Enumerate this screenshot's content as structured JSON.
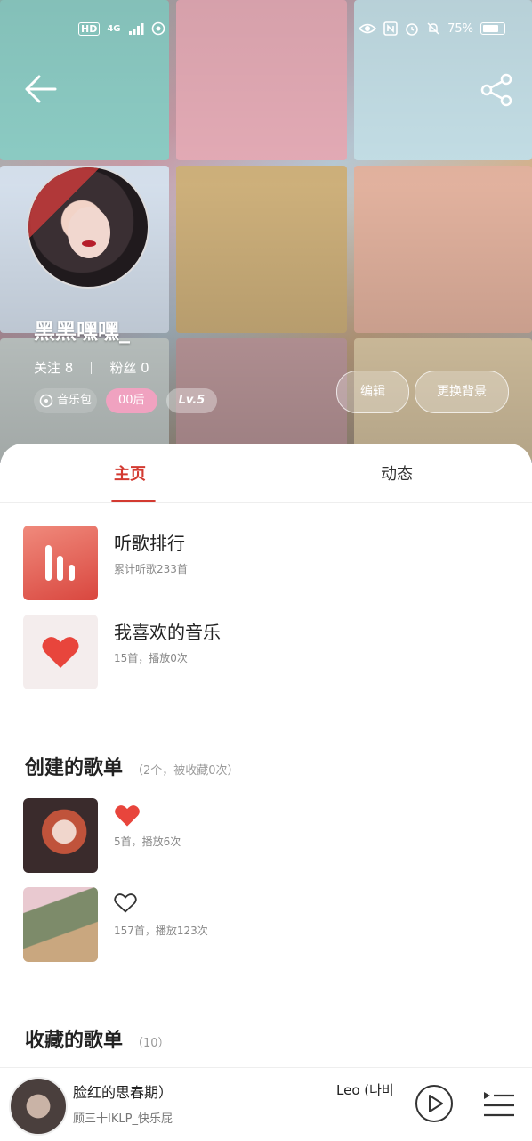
{
  "status_bar": {
    "left": [
      "HD",
      "4G",
      "signal-icon",
      "hotspot-icon"
    ],
    "battery_percent": "75%",
    "icons_right": [
      "eye-icon",
      "nfc-icon",
      "alarm-icon",
      "mute-icon",
      "battery-icon"
    ]
  },
  "profile": {
    "username": "黑黑嘿嘿_",
    "follow_label": "关注 8",
    "fans_label": "粉丝 0",
    "brand_tag": "音乐包",
    "age_tag": "00后",
    "level_tag": "Lv.5",
    "edit_button": "编辑",
    "change_bg_button": "更换背景"
  },
  "tabs": {
    "home": "主页",
    "activity": "动态"
  },
  "overview": [
    {
      "title": "听歌排行",
      "subtitle": "累计听歌233首"
    },
    {
      "title": "我喜欢的音乐",
      "subtitle": "15首，播放0次"
    }
  ],
  "created_playlists": {
    "title": "创建的歌单",
    "summary": "（2个，被收藏0次）",
    "items": [
      {
        "subtitle": "5首，播放6次",
        "icon": "heart-filled-icon"
      },
      {
        "subtitle": "157首，播放123次",
        "icon": "heart-outline-icon"
      }
    ]
  },
  "collected_playlists": {
    "title": "收藏的歌单",
    "summary": "（10）"
  },
  "player": {
    "song": "脸红的思春期）",
    "song_prefix": "）",
    "artist_right": "Leo (나비",
    "artist_line": "顾三十IKLP_快乐屁"
  },
  "colors": {
    "accent": "#d33a31",
    "heart": "#e8453c",
    "age_pill": "#f0a2c0"
  }
}
